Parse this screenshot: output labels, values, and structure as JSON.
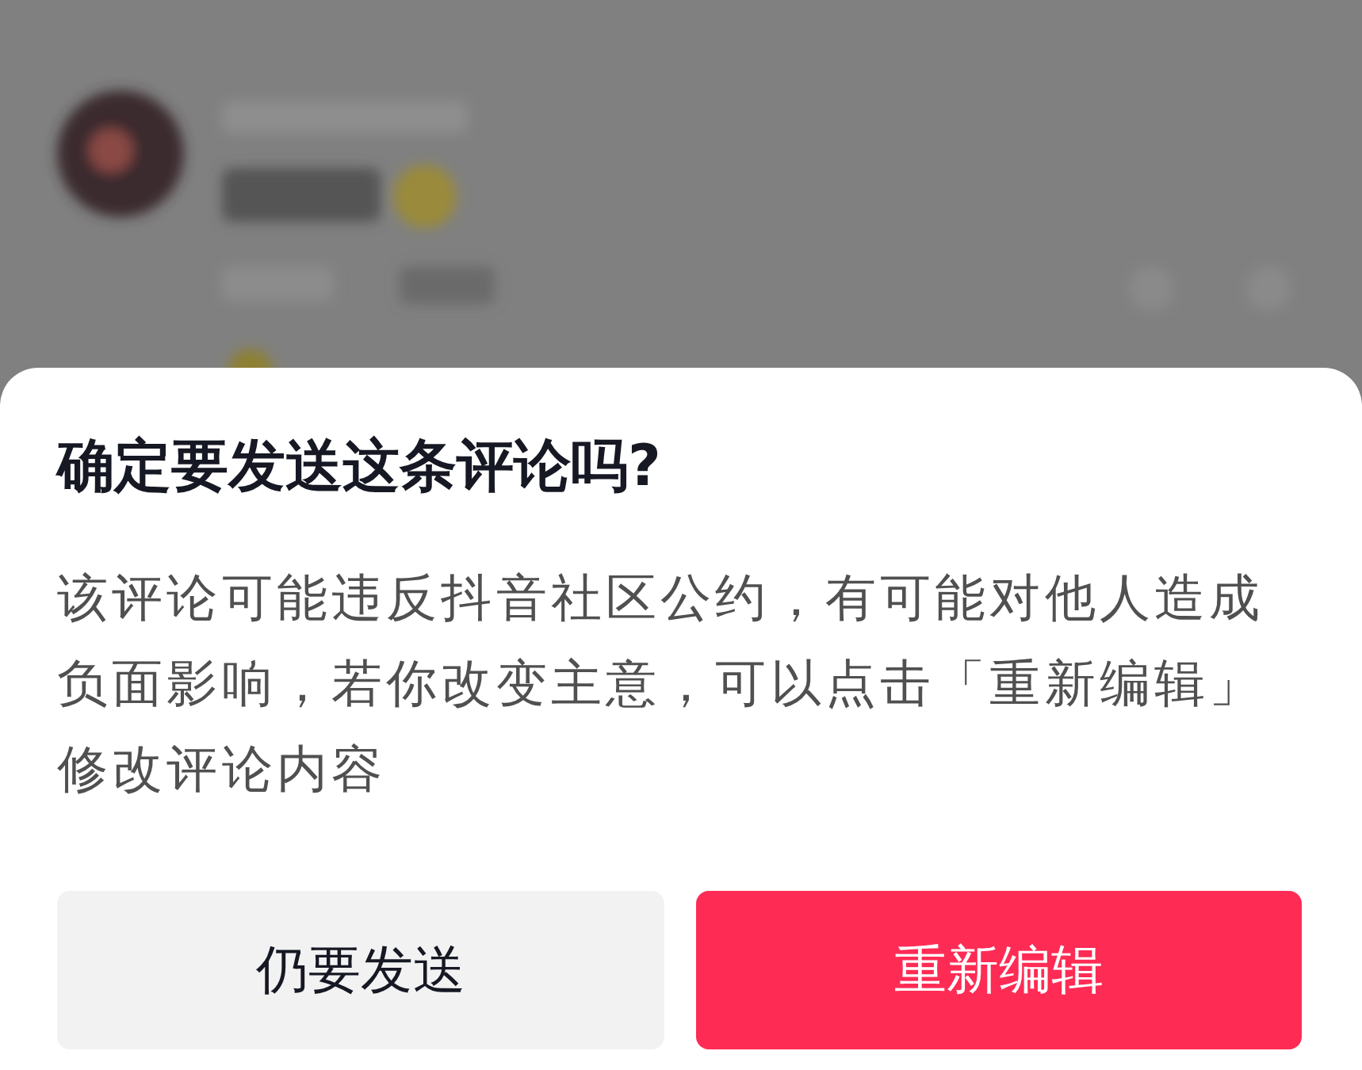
{
  "dialog": {
    "title": "确定要发送这条评论吗?",
    "message": "该评论可能违反抖音社区公约，有可能对他人造成负面影响，若你改变主意，可以点击「重新编辑」修改评论内容",
    "buttons": [
      {
        "label": "仍要发送",
        "kind": "secondary"
      },
      {
        "label": "重新编辑",
        "kind": "primary"
      }
    ]
  }
}
